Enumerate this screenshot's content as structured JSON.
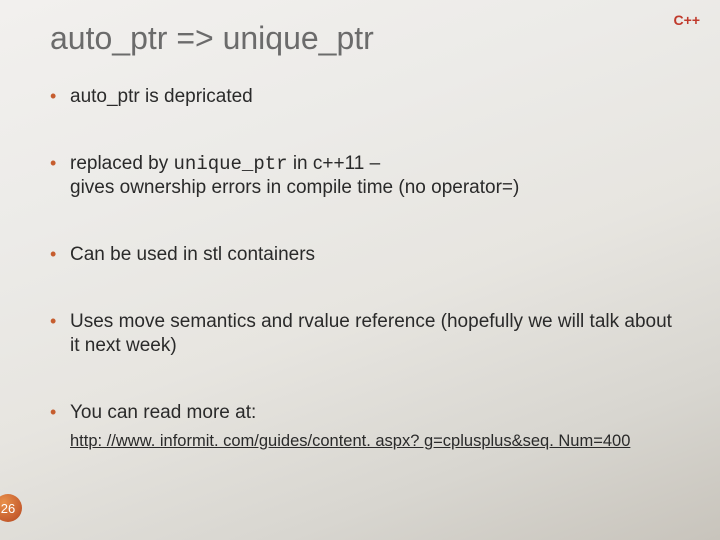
{
  "badge": "C++",
  "title": "auto_ptr => unique_ptr",
  "bullets": {
    "b1": "auto_ptr is depricated",
    "b2_prefix": "replaced by ",
    "b2_code": "unique_ptr",
    "b2_mid": " in c++11 –",
    "b2_line2": "gives ownership errors in compile time (no operator=)",
    "b3": "Can be used in stl containers",
    "b4": "Uses move semantics and rvalue reference (hopefully we will talk about it next week)",
    "b5": "You can read more at:"
  },
  "link_text": "http: //www. informit. com/guides/content. aspx? g=cplusplus&seq. Num=400",
  "page_number": "26"
}
